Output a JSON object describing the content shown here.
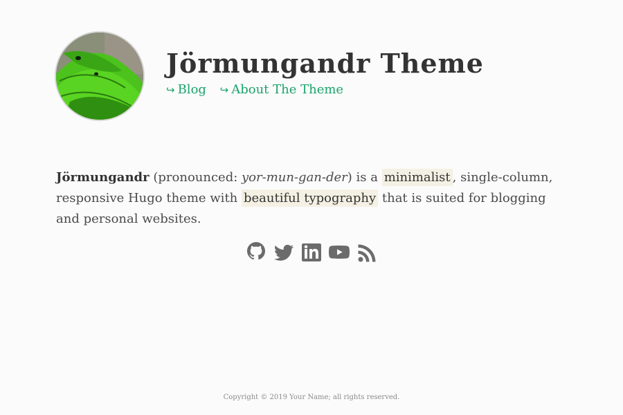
{
  "header": {
    "title": "Jörmungandr Theme",
    "avatar_alt": "avatar",
    "nav": [
      {
        "arrow": "↪",
        "label": "Blog"
      },
      {
        "arrow": "↪",
        "label": "About The Theme"
      }
    ]
  },
  "intro": {
    "name": "Jörmungandr",
    "pronounced_prefix": " (pronounced: ",
    "pronunciation": "yor-mun-gan-der",
    "after_pronunciation": ") is a ",
    "highlight1": "minimalist",
    "middle": ", single-column, responsive Hugo theme with ",
    "highlight2": "beautiful typography",
    "end": " that is suited for blogging and personal websites."
  },
  "socials": [
    "github-icon",
    "twitter-icon",
    "linkedin-icon",
    "youtube-icon",
    "rss-icon"
  ],
  "footer": {
    "text": "Copyright © 2019 Your Name; all rights reserved."
  },
  "colors": {
    "accent": "#1ba36c",
    "highlight_bg": "#f4f0e3",
    "icon": "#6b6b6b"
  }
}
